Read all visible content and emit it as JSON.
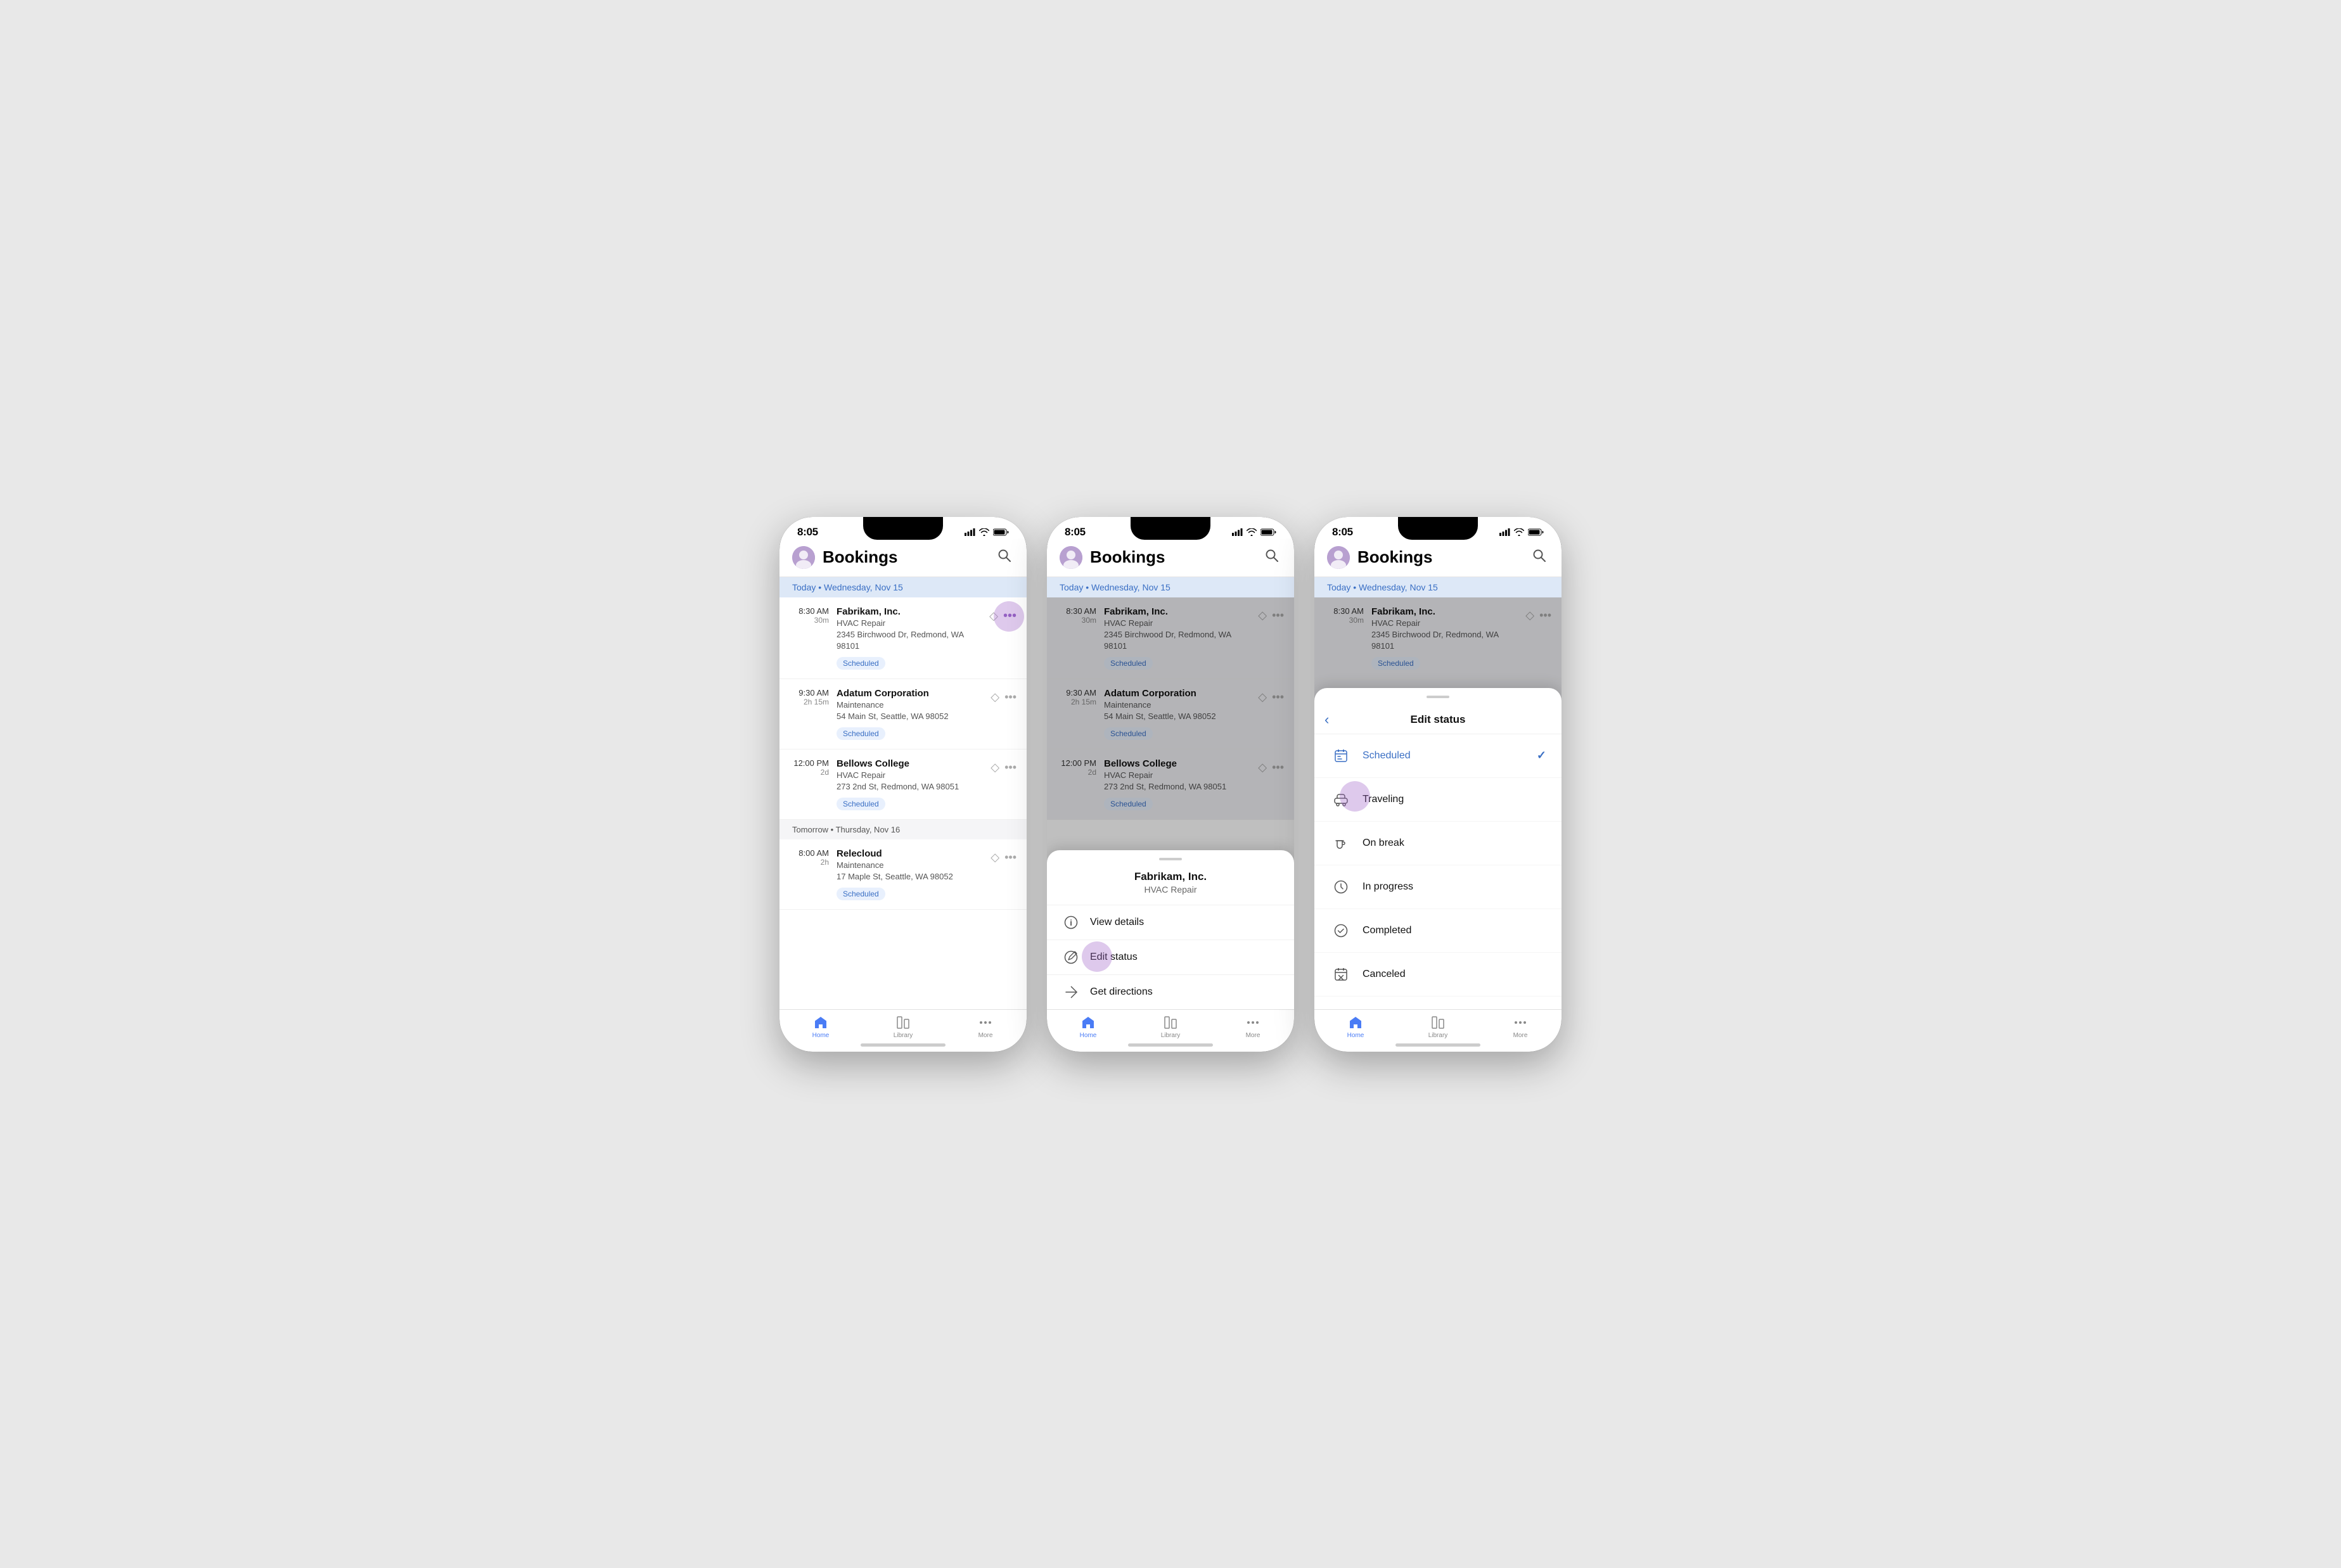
{
  "statusBar": {
    "time": "8:05"
  },
  "header": {
    "title": "Bookings",
    "searchLabel": "Search"
  },
  "dateHeader": {
    "today": "Today • Wednesday, Nov 15",
    "tomorrow": "Tomorrow • Thursday, Nov 16"
  },
  "bookings": [
    {
      "time": "8:30 AM",
      "duration": "30m",
      "company": "Fabrikam, Inc.",
      "service": "HVAC Repair",
      "address": "2345 Birchwood Dr, Redmond, WA 98101",
      "status": "Scheduled"
    },
    {
      "time": "9:30 AM",
      "duration": "2h 15m",
      "company": "Adatum Corporation",
      "service": "Maintenance",
      "address": "54 Main St, Seattle, WA 98052",
      "status": "Scheduled"
    },
    {
      "time": "12:00 PM",
      "duration": "2d",
      "company": "Bellows College",
      "service": "HVAC Repair",
      "address": "273 2nd St, Redmond, WA 98051",
      "status": "Scheduled"
    }
  ],
  "tomorrowBookings": [
    {
      "time": "8:00 AM",
      "duration": "2h",
      "company": "Relecloud",
      "service": "Maintenance",
      "address": "17 Maple St, Seattle, WA 98052",
      "status": "Scheduled"
    }
  ],
  "bottomNav": {
    "home": "Home",
    "library": "Library",
    "more": "More"
  },
  "contextMenu": {
    "companyName": "Fabrikam, Inc.",
    "service": "HVAC Repair",
    "viewDetails": "View details",
    "editStatus": "Edit status",
    "getDirections": "Get directions"
  },
  "editStatus": {
    "title": "Edit status",
    "options": [
      {
        "label": "Scheduled",
        "active": true
      },
      {
        "label": "Traveling",
        "active": false
      },
      {
        "label": "On break",
        "active": false
      },
      {
        "label": "In progress",
        "active": false
      },
      {
        "label": "Completed",
        "active": false
      },
      {
        "label": "Canceled",
        "active": false
      }
    ]
  },
  "colors": {
    "accent": "#3a6fc4",
    "badgeBg": "#e8f0fd",
    "dateHeaderBg": "#dde8f7"
  }
}
